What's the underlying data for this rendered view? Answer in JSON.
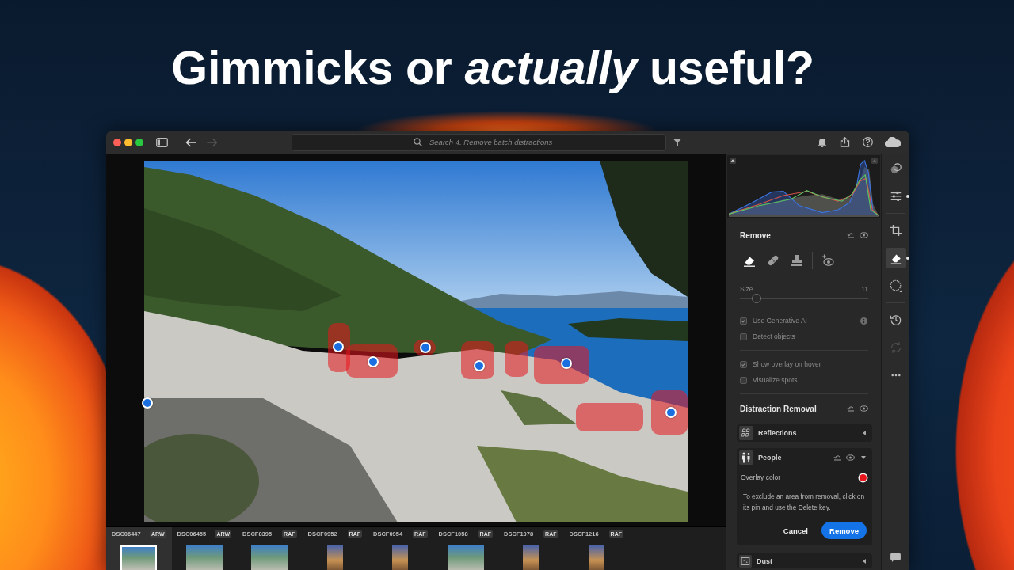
{
  "headline": "Gimmicks or *actually* useful?",
  "titlebar": {
    "nav": [
      {
        "kind": "back",
        "disabled": false
      },
      {
        "kind": "forward",
        "disabled": true
      }
    ],
    "search": {
      "placeholder": "Search 4. Remove batch distractions"
    }
  },
  "remove_panel": {
    "title": "Remove",
    "tools": [
      {
        "kind": "eraser",
        "selected": true
      },
      {
        "kind": "heal",
        "selected": false
      },
      {
        "kind": "clone",
        "selected": false
      },
      {
        "kind": "visualize",
        "selected": false
      }
    ],
    "size": {
      "label": "Size",
      "value": "11",
      "level": 0.13,
      "disabled": true
    },
    "option_groups": [
      {
        "options": [
          {
            "label": "Use Generative AI",
            "checked": true,
            "disabled": true,
            "info": true
          },
          {
            "label": "Detect objects",
            "checked": false,
            "disabled": true,
            "info": false
          }
        ]
      },
      {
        "options": [
          {
            "label": "Show overlay on hover",
            "checked": true,
            "disabled": true,
            "info": false
          },
          {
            "label": "Visualize spots",
            "checked": false,
            "disabled": true,
            "info": false
          }
        ]
      }
    ]
  },
  "distraction_removal": {
    "title": "Distraction Removal",
    "categories": [
      {
        "kind": "reflections",
        "label": "Reflections",
        "expanded": false
      },
      {
        "kind": "people",
        "label": "People",
        "expanded": true,
        "overlay": {
          "label": "Overlay color",
          "color": "#e8151d"
        },
        "help": "To exclude an area from removal, click on its pin and use the Delete key.",
        "buttons": [
          {
            "kind": "secondary",
            "label": "Cancel"
          },
          {
            "kind": "primary",
            "label": "Remove"
          }
        ]
      },
      {
        "kind": "dust",
        "label": "Dust",
        "expanded": false
      }
    ]
  },
  "tool_strip": {
    "groups": [
      {
        "tools": [
          {
            "kind": "presets",
            "selected": false,
            "indicator": false,
            "disabled": false
          },
          {
            "kind": "edit",
            "selected": false,
            "indicator": true,
            "disabled": false
          }
        ]
      },
      {
        "tools": [
          {
            "kind": "crop",
            "selected": false,
            "indicator": false,
            "disabled": false
          },
          {
            "kind": "remove",
            "selected": true,
            "indicator": true,
            "disabled": false
          },
          {
            "kind": "masking",
            "selected": false,
            "indicator": false,
            "disabled": false
          }
        ]
      },
      {
        "tools": [
          {
            "kind": "history",
            "selected": false,
            "indicator": false,
            "disabled": false
          },
          {
            "kind": "versions",
            "selected": false,
            "indicator": false,
            "disabled": true
          },
          {
            "kind": "more",
            "selected": false,
            "indicator": false,
            "disabled": false
          }
        ]
      }
    ],
    "bottom": [
      {
        "kind": "comments",
        "selected": false,
        "indicator": false,
        "disabled": false
      }
    ]
  },
  "filmstrip": [
    {
      "name": "DSC06447",
      "format": "ARW",
      "kind": "landscape",
      "selected": true
    },
    {
      "name": "DSC06455",
      "format": "ARW",
      "kind": "landscape",
      "selected": false
    },
    {
      "name": "DSCF8395",
      "format": "RAF",
      "kind": "landscape",
      "selected": false
    },
    {
      "name": "DSCF0952",
      "format": "RAF",
      "kind": "portrait",
      "selected": false
    },
    {
      "name": "DSCF0954",
      "format": "RAF",
      "kind": "portrait",
      "selected": false
    },
    {
      "name": "DSCF1058",
      "format": "RAF",
      "kind": "landscape",
      "selected": false
    },
    {
      "name": "DSCF1078",
      "format": "RAF",
      "kind": "portrait",
      "selected": false
    },
    {
      "name": "DSCF1216",
      "format": "RAF",
      "kind": "portrait",
      "selected": false
    }
  ]
}
